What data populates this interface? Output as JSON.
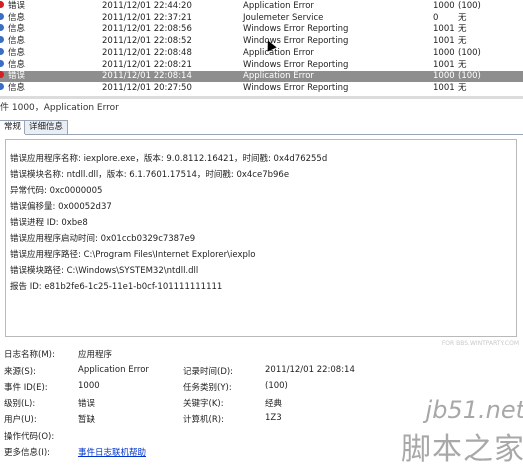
{
  "events": [
    {
      "level": "错误",
      "date": "2011/12/01 22:44:20",
      "source": "Application Error",
      "id": "1000",
      "task": "(100)",
      "type": "err",
      "selected": false
    },
    {
      "level": "信息",
      "date": "2011/12/01 22:37:21",
      "source": "Joulemeter Service",
      "id": "0",
      "task": "无",
      "type": "info",
      "selected": false
    },
    {
      "level": "信息",
      "date": "2011/12/01 22:08:56",
      "source": "Windows Error Reporting",
      "id": "1001",
      "task": "无",
      "type": "info",
      "selected": false
    },
    {
      "level": "信息",
      "date": "2011/12/01 22:08:52",
      "source": "Windows Error Reporting",
      "id": "1001",
      "task": "无",
      "type": "info",
      "selected": false
    },
    {
      "level": "信息",
      "date": "2011/12/01 22:08:48",
      "source": "Application Error",
      "id": "1000",
      "task": "(100)",
      "type": "info",
      "selected": false
    },
    {
      "level": "信息",
      "date": "2011/12/01 22:08:21",
      "source": "Windows Error Reporting",
      "id": "1001",
      "task": "无",
      "type": "info",
      "selected": false
    },
    {
      "level": "错误",
      "date": "2011/12/01 22:08:14",
      "source": "Application Error",
      "id": "1000",
      "task": "(100)",
      "type": "err",
      "selected": true
    },
    {
      "level": "信息",
      "date": "2011/12/01 20:27:50",
      "source": "Windows Error Reporting",
      "id": "1001",
      "task": "无",
      "type": "info",
      "selected": false
    }
  ],
  "event_title": "件 1000，Application Error",
  "tabs": {
    "general": "常规",
    "details": "详细信息"
  },
  "detail_lines": [
    "错误应用程序名称: iexplore.exe，版本: 9.0.8112.16421，时间戳: 0x4d76255d",
    "错误模块名称: ntdll.dll，版本: 6.1.7601.17514，时间戳: 0x4ce7b96e",
    "异常代码: 0xc0000005",
    "错误偏移量: 0x00052d37",
    "错误进程 ID: 0xbe8",
    "错误应用程序启动时间: 0x01ccb0329c7387e9",
    "错误应用程序路径: C:\\Program Files\\Internet Explorer\\iexplo",
    "错误模块路径: C:\\Windows\\SYSTEM32\\ntdll.dll",
    "报告 ID: e81b2fe6-1c25-11e1-b0cf-101111111111"
  ],
  "props": {
    "log_name_label": "日志名称(M):",
    "log_name": "应用程序",
    "source_label": "来源(S):",
    "source": "Application Error",
    "logged_label": "记录时间(D):",
    "logged": "2011/12/01 22:08:14",
    "event_id_label": "事件 ID(E):",
    "event_id": "1000",
    "task_label": "任务类别(Y):",
    "task": "(100)",
    "level_label": "级别(L):",
    "level": "错误",
    "keywords_label": "关键字(K):",
    "keywords": "经典",
    "user_label": "用户(U):",
    "user": "暂缺",
    "computer_label": "计算机(R):",
    "computer": "1Z3",
    "opcode_label": "操作代码(O):",
    "more_info_label": "更多信息(I):",
    "more_info_link": "事件日志联机帮助"
  },
  "watermark": {
    "small": "FOR BBS.WINTPARTY.COM",
    "url": "jb51.net",
    "cn": "脚本之家"
  }
}
